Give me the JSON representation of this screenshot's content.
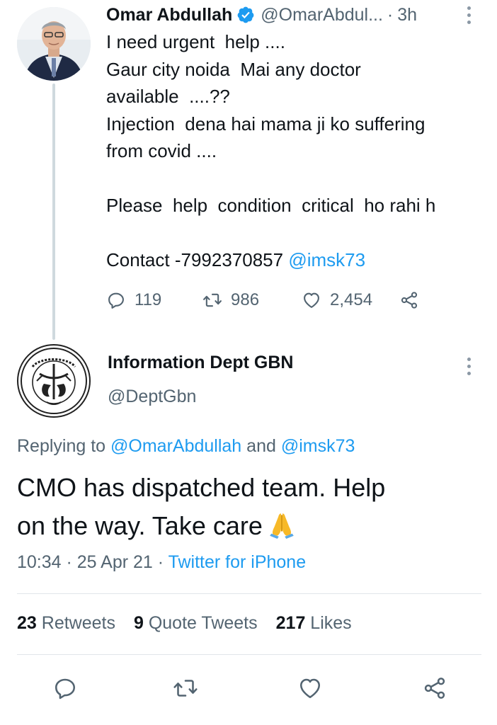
{
  "parent_tweet": {
    "author_name": "Omar Abdullah",
    "handle": "@OmarAbdul...",
    "separator": "·",
    "time": "3h",
    "text_lines": [
      "I need urgent  help ....",
      "Gaur city noida  Mai any doctor",
      "available  ....??",
      "Injection  dena hai mama ji ko suffering",
      "from covid ....",
      "",
      "Please  help  condition  critical  ho rahi h",
      "",
      "Contact -7992370857 "
    ],
    "contact_mention": "@imsk73",
    "reply_count": "119",
    "retweet_count": "986",
    "like_count": "2,454",
    "icons": {
      "reply": "reply-icon",
      "retweet": "retweet-icon",
      "like": "heart-icon",
      "share": "share-icon",
      "verified": "verified-badge-icon",
      "more": "more-vertical-icon"
    }
  },
  "reply_tweet": {
    "author_name": "Information Dept GBN",
    "handle": "@DeptGbn",
    "replying_prefix": "Replying to ",
    "replying_to_1": "@OmarAbdullah",
    "replying_and": " and ",
    "replying_to_2": "@imsk73",
    "text_line_1": "CMO has dispatched team. Help",
    "text_line_2": "on the way. Take care",
    "emoji": "folded-hands-emoji",
    "timestamp": "10:34 · 25 Apr 21 · ",
    "source": "Twitter for iPhone",
    "stats": {
      "retweets_num": "23",
      "retweets_label": " Retweets",
      "quotes_num": "9",
      "quotes_label": " Quote Tweets",
      "likes_num": "217",
      "likes_label": " Likes"
    }
  },
  "colors": {
    "accent": "#1d9bf0",
    "text": "#0f1419",
    "secondary": "#536471",
    "divider": "#e1e6ea"
  }
}
